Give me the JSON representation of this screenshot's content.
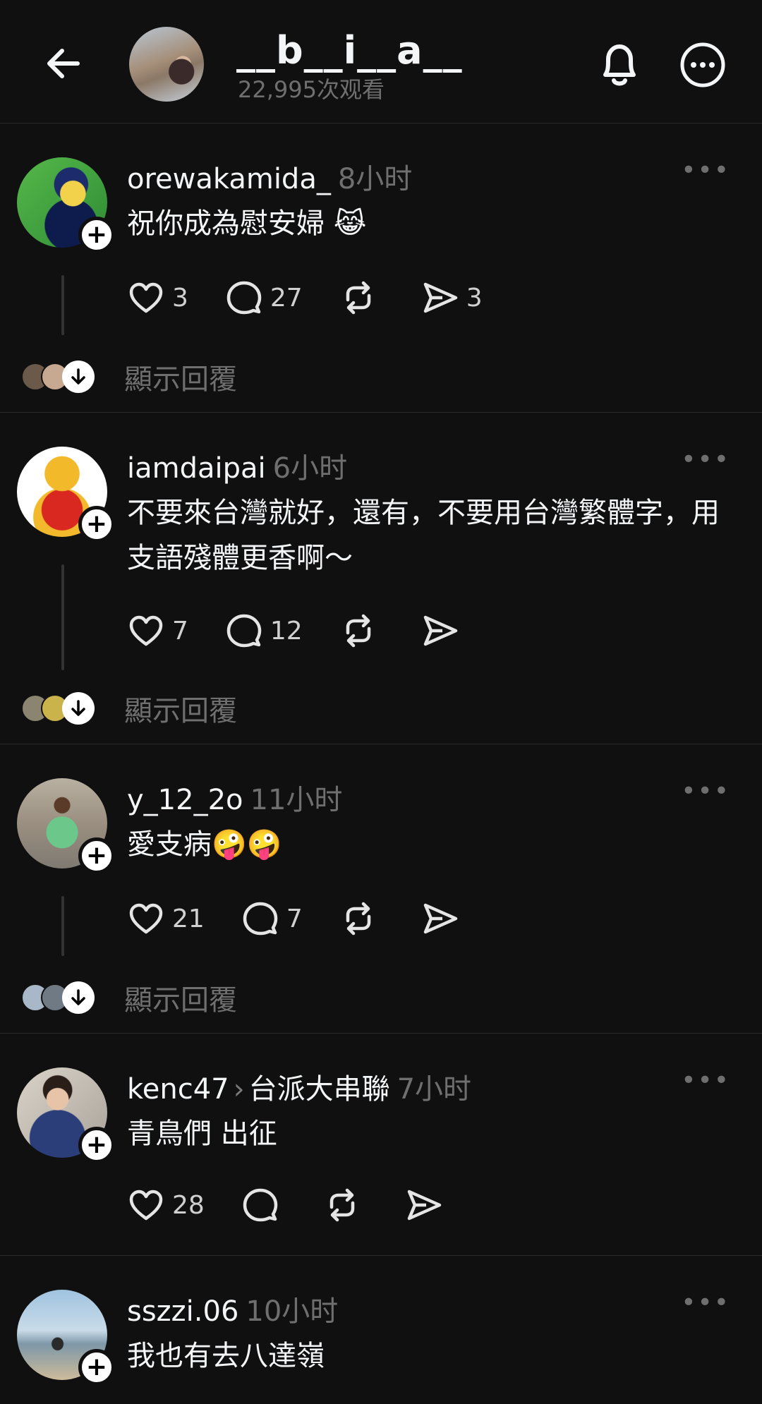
{
  "header": {
    "title": "__b__i__a__",
    "views": "22,995次观看"
  },
  "posts": [
    {
      "username": "orewakamida_",
      "community": "",
      "time": "8小时",
      "text": "祝你成為慰安婦 😹",
      "likes": "3",
      "comments": "27",
      "reposts": "",
      "shares": "3",
      "show_replies": "顯示回覆"
    },
    {
      "username": "iamdaipai",
      "community": "",
      "time": "6小时",
      "text": "不要來台灣就好，還有，不要用台灣繁體字，用支語殘體更香啊～",
      "likes": "7",
      "comments": "12",
      "reposts": "",
      "shares": "",
      "show_replies": "顯示回覆"
    },
    {
      "username": "y_12_2o",
      "community": "",
      "time": "11小时",
      "text": "愛支病🤪🤪",
      "likes": "21",
      "comments": "7",
      "reposts": "",
      "shares": "",
      "show_replies": "顯示回覆"
    },
    {
      "username": "kenc47",
      "community": "台派大串聯",
      "time": "7小时",
      "text": "青鳥們 出征",
      "likes": "28",
      "comments": "",
      "reposts": "",
      "shares": ""
    },
    {
      "username": "sszzi.06",
      "community": "",
      "time": "10小时",
      "text": "我也有去八達嶺"
    }
  ],
  "icons": {
    "back": "arrow-left-icon",
    "bell": "bell-icon",
    "more": "more-circle-icon",
    "like": "heart-icon",
    "comment": "comment-icon",
    "repost": "repost-icon",
    "share": "send-icon",
    "expand": "arrow-down-icon"
  }
}
